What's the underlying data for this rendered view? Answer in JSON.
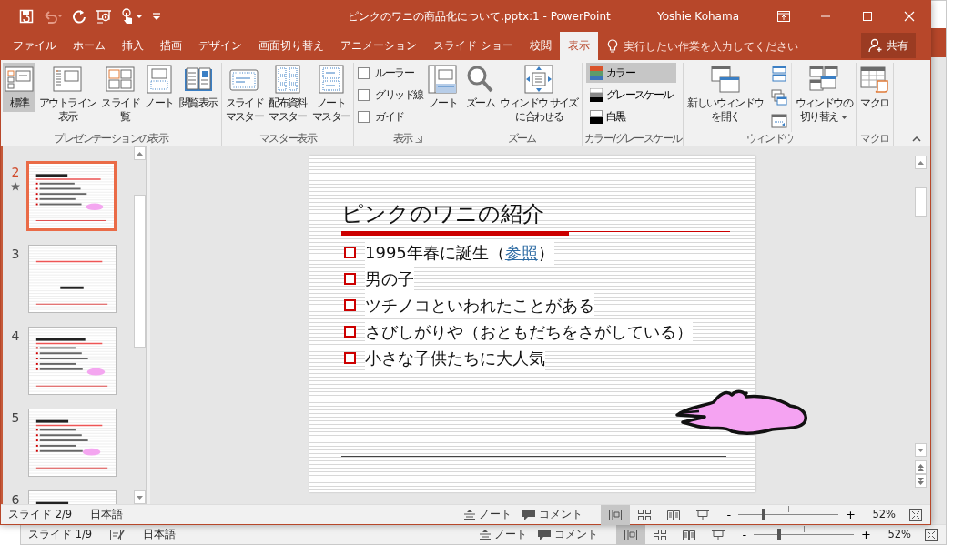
{
  "window": {
    "title": "ピンクのワニの商品化について.pptx:1 - PowerPoint",
    "user": "Yoshie Kohama"
  },
  "tabs": [
    {
      "label": "ファイル",
      "selected": false
    },
    {
      "label": "ホーム",
      "selected": false
    },
    {
      "label": "挿入",
      "selected": false
    },
    {
      "label": "描画",
      "selected": false
    },
    {
      "label": "デザイン",
      "selected": false
    },
    {
      "label": "画面切り替え",
      "selected": false
    },
    {
      "label": "アニメーション",
      "selected": false
    },
    {
      "label": "スライド ショー",
      "selected": false
    },
    {
      "label": "校閲",
      "selected": false
    },
    {
      "label": "表示",
      "selected": true
    }
  ],
  "tell_me": {
    "placeholder": "実行したい作業を入力してください"
  },
  "share_button": "共有",
  "ribbon_groups": [
    {
      "label": "プレゼンテーションの表示",
      "items": [
        {
          "kind": "large",
          "lines": [
            "標準"
          ],
          "selected": true
        },
        {
          "kind": "large",
          "lines": [
            "アウトライン",
            "表示"
          ],
          "selected": false
        },
        {
          "kind": "large",
          "lines": [
            "スライド",
            "一覧"
          ],
          "selected": false
        },
        {
          "kind": "large",
          "lines": [
            "ノート"
          ],
          "selected": false
        },
        {
          "kind": "large",
          "lines": [
            "閲覧表示"
          ],
          "selected": false
        }
      ]
    },
    {
      "label": "マスター表示",
      "items": [
        {
          "kind": "large",
          "lines": [
            "スライド",
            "マスター"
          ],
          "selected": false
        },
        {
          "kind": "large",
          "lines": [
            "配布資料",
            "マスター"
          ],
          "selected": false
        },
        {
          "kind": "large",
          "lines": [
            "ノート",
            "マスター"
          ],
          "selected": false
        }
      ]
    },
    {
      "label": "表示",
      "launcher": true,
      "items": [
        {
          "kind": "checkbox",
          "label": "ルーラー",
          "checked": false
        },
        {
          "kind": "checkbox",
          "label": "グリッド線",
          "checked": false
        },
        {
          "kind": "checkbox",
          "label": "ガイド",
          "checked": false
        },
        {
          "kind": "large",
          "lines": [
            "ノート"
          ],
          "selected": false
        }
      ]
    },
    {
      "label": "ズーム",
      "items": [
        {
          "kind": "large",
          "lines": [
            "ズーム"
          ],
          "selected": false
        },
        {
          "kind": "large",
          "lines": [
            "ウィンドウ サイズ",
            "に合わせる"
          ],
          "selected": false
        }
      ]
    },
    {
      "label": "カラー/グレースケール",
      "items": [
        {
          "kind": "option",
          "label": "カラー",
          "selected": true
        },
        {
          "kind": "option",
          "label": "グレースケール",
          "selected": false
        },
        {
          "kind": "option",
          "label": "白黒",
          "selected": false
        }
      ]
    },
    {
      "label": "ウィンドウ",
      "items": [
        {
          "kind": "large",
          "lines": [
            "新しいウィンドウ",
            "を開く"
          ],
          "selected": false
        },
        {
          "kind": "small"
        },
        {
          "kind": "small"
        },
        {
          "kind": "small"
        },
        {
          "kind": "large",
          "lines": [
            "ウィンドウの",
            "切り替え"
          ],
          "selected": false,
          "dropdown": true
        }
      ]
    },
    {
      "label": "マクロ",
      "items": [
        {
          "kind": "large",
          "lines": [
            "マクロ"
          ],
          "selected": false
        }
      ]
    }
  ],
  "thumbnails": [
    {
      "number": "2",
      "selected": true,
      "animated": true
    },
    {
      "number": "3",
      "selected": false,
      "animated": false
    },
    {
      "number": "4",
      "selected": false,
      "animated": false
    },
    {
      "number": "5",
      "selected": false,
      "animated": false
    },
    {
      "number": "6",
      "selected": false,
      "animated": false
    }
  ],
  "slide": {
    "title": "ピンクのワニの紹介",
    "bullets": [
      {
        "text": "1995年春に誕生（",
        "link": "参照",
        "after": "）"
      },
      {
        "text": "男の子"
      },
      {
        "text": "ツチノコといわれたことがある"
      },
      {
        "text": "さびしがりや（おともだちをさがしている）"
      },
      {
        "text": "小さな子供たちに大人気"
      }
    ]
  },
  "status_bar": {
    "left": [
      {
        "kind": "text",
        "text": "スライド 2/9"
      },
      {
        "kind": "text",
        "text": "日本語"
      }
    ],
    "notes": "ノート",
    "comments": "コメント",
    "views": [
      {
        "selected": true
      },
      {
        "selected": false
      },
      {
        "selected": false
      },
      {
        "selected": false
      }
    ],
    "zoom": {
      "minus": "-",
      "plus": "+",
      "level": 0.25,
      "reading": "52%"
    }
  },
  "back_window": {
    "status_bar": {
      "left": [
        {
          "kind": "text",
          "text": "スライド 1/9"
        },
        {
          "kind": "proofing"
        },
        {
          "kind": "text",
          "text": "日本語"
        }
      ],
      "notes": "ノート",
      "comments": "コメント",
      "views": [
        {
          "selected": true
        },
        {
          "selected": false
        },
        {
          "selected": false
        },
        {
          "selected": false
        }
      ],
      "zoom": {
        "minus": "-",
        "plus": "+",
        "level": 0.25,
        "reading": "52%"
      }
    }
  }
}
